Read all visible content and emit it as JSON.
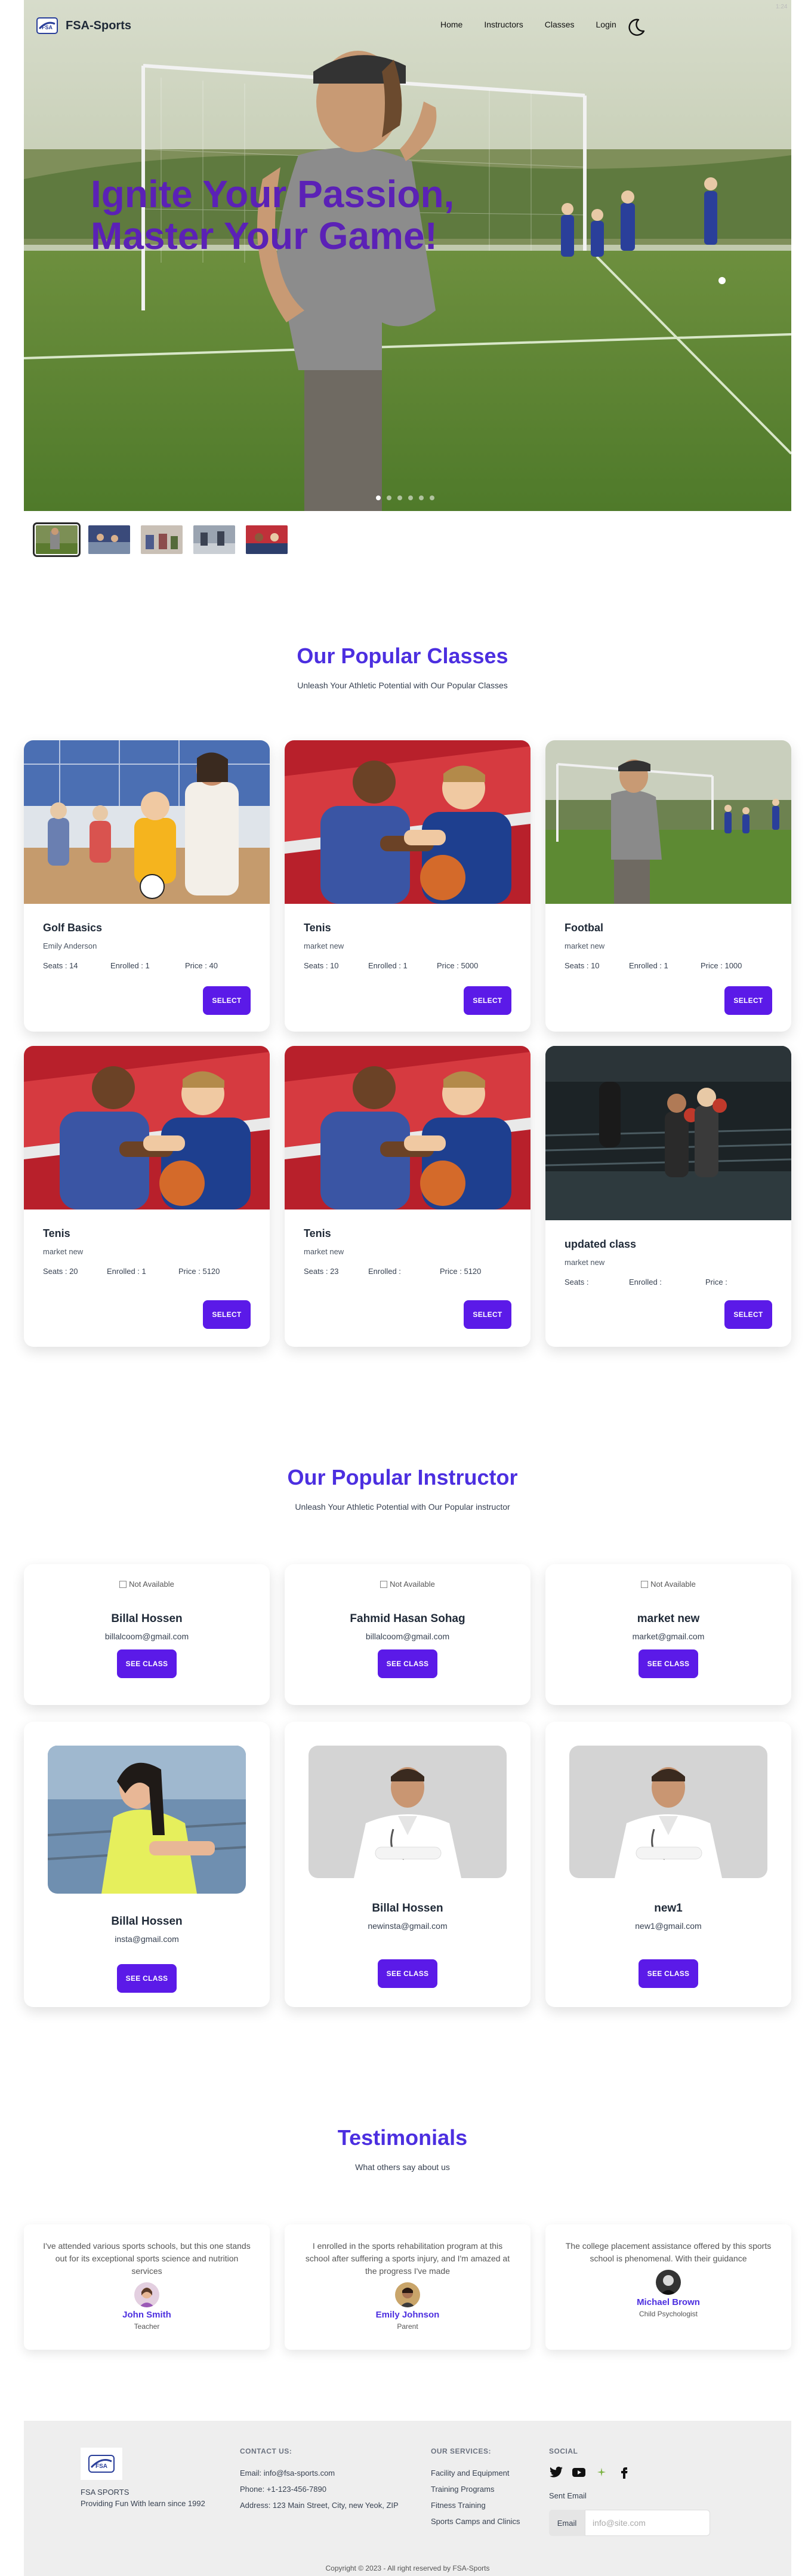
{
  "nav": {
    "brand": "FSA-Sports",
    "links": [
      "Home",
      "Instructors",
      "Classes",
      "Login"
    ],
    "corner": "1:24"
  },
  "hero": {
    "title": "Ignite Your Passion, Master Your Game!",
    "slide_count": 6,
    "active_slide": 0
  },
  "classes_section": {
    "title": "Our Popular Classes",
    "subtitle": "Unleash Your Athletic Potential with Our Popular Classes",
    "button_label": "SELECT",
    "seats_label": "Seats : ",
    "enrolled_label": "Enrolled : ",
    "price_label": "Price : ",
    "cards": [
      {
        "name": "Golf Basics",
        "instructor": "Emily Anderson",
        "seats": "14",
        "enrolled": "1",
        "price": "40",
        "image": "kids-gym"
      },
      {
        "name": "Tenis",
        "instructor": "market new",
        "seats": "10",
        "enrolled": "1",
        "price": "5000",
        "image": "basketball-duo"
      },
      {
        "name": "Footbal",
        "instructor": "market new",
        "seats": "10",
        "enrolled": "1",
        "price": "1000",
        "image": "football-coach"
      },
      {
        "name": "Tenis",
        "instructor": "market new",
        "seats": "20",
        "enrolled": "1",
        "price": "5120",
        "image": "basketball-duo"
      },
      {
        "name": "Tenis",
        "instructor": "market new",
        "seats": "23",
        "enrolled": "",
        "price": "5120",
        "image": "basketball-duo"
      },
      {
        "name": "updated class",
        "instructor": "market new",
        "seats": "",
        "enrolled": "",
        "price": "",
        "image": "boxing-ring"
      }
    ]
  },
  "instructors_section": {
    "title": "Our Popular Instructor",
    "subtitle": "Unleash Your Athletic Potential with Our Popular instructor",
    "button_label": "SEE CLASS",
    "broken_image_alt": "Not Available",
    "cards": [
      {
        "name": "Billal Hossen",
        "email": "billalcoom@gmail.com",
        "photo": "none"
      },
      {
        "name": "Fahmid Hasan Sohag",
        "email": "billalcoom@gmail.com",
        "photo": "none"
      },
      {
        "name": "market new",
        "email": "market@gmail.com",
        "photo": "none"
      },
      {
        "name": "Billal Hossen",
        "email": "insta@gmail.com",
        "photo": "woman-yellow"
      },
      {
        "name": "Billal Hossen",
        "email": "newinsta@gmail.com",
        "photo": "doctor"
      },
      {
        "name": "new1",
        "email": "new1@gmail.com",
        "photo": "doctor"
      }
    ]
  },
  "testimonials_section": {
    "title": "Testimonials",
    "subtitle": "What others say about us",
    "items": [
      {
        "text": "I've attended various sports schools, but this one stands out for its exceptional sports science and nutrition services",
        "name": "John Smith",
        "role": "Teacher"
      },
      {
        "text": "I enrolled in the sports rehabilitation program at this school after suffering a sports injury, and I'm amazed at the progress I've made",
        "name": "Emily Johnson",
        "role": "Parent"
      },
      {
        "text": "The college placement assistance offered by this sports school is phenomenal. With their guidance",
        "name": "Michael Brown",
        "role": "Child Psychologist"
      }
    ]
  },
  "footer": {
    "brand_name": "FSA SPORTS",
    "tagline": "Providing Fun With learn since 1992",
    "contact": {
      "heading": "CONTACT US:",
      "email": "Email: info@fsa-sports.com",
      "phone": "Phone: +1-123-456-7890",
      "address": "Address: 123 Main Street, City, new Yeok, ZIP"
    },
    "services": {
      "heading": "OUR SERVICES:",
      "items": [
        "Facility and Equipment",
        "Training Programs",
        "Fitness Training",
        "Sports Camps and Clinics"
      ]
    },
    "social": {
      "heading": "SOCIAL",
      "icons": [
        "twitter-icon",
        "youtube-icon",
        "sparkle-icon",
        "facebook-icon"
      ],
      "sent_label": "Sent Email",
      "email_label": "Email",
      "email_placeholder": "info@site.com"
    },
    "copyright": "Copyright © 2023 - All right reserved by FSA-Sports"
  },
  "colors": {
    "accent": "#5b1ae8",
    "heading": "#4c2fe0",
    "hero_title": "#5b21b6"
  }
}
